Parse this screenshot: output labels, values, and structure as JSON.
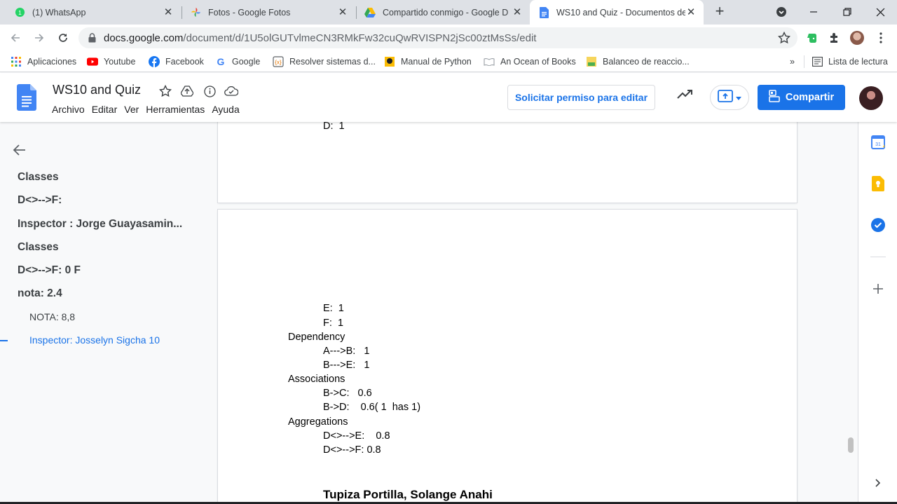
{
  "browser": {
    "tabs": [
      {
        "title": "(1) WhatsApp",
        "icon": "whatsapp-icon"
      },
      {
        "title": "Fotos - Google Fotos",
        "icon": "google-photos-icon"
      },
      {
        "title": "Compartido conmigo - Google D",
        "icon": "google-drive-icon"
      },
      {
        "title": "WS10 and Quiz - Documentos de",
        "icon": "google-docs-icon"
      }
    ],
    "url_host": "docs.google.com",
    "url_path": "/document/d/1U5olGUTvlmeCN3RMkFw32cuQwRVISPN2jSc00ztMsSs/edit",
    "bookmarks": [
      {
        "label": "Aplicaciones",
        "icon": "apps-grid-icon"
      },
      {
        "label": "Youtube",
        "icon": "youtube-icon"
      },
      {
        "label": "Facebook",
        "icon": "facebook-icon"
      },
      {
        "label": "Google",
        "icon": "google-icon"
      },
      {
        "label": "Resolver sistemas d...",
        "icon": "calculator-icon"
      },
      {
        "label": "Manual de Python",
        "icon": "python-book-icon"
      },
      {
        "label": "An Ocean of Books",
        "icon": "book-icon"
      },
      {
        "label": "Balanceo de reaccio...",
        "icon": "chemistry-icon"
      }
    ],
    "bookmarks_overflow": "»",
    "reading_list": "Lista de lectura"
  },
  "docs": {
    "title": "WS10 and Quiz",
    "menu": [
      "Archivo",
      "Editar",
      "Ver",
      "Herramientas",
      "Ayuda"
    ],
    "request_edit": "Solicitar permiso para editar",
    "share": "Compartir"
  },
  "outline": {
    "items": [
      {
        "label": "Classes",
        "level": "h2"
      },
      {
        "label": "D<>-->F:",
        "level": "h2"
      },
      {
        "label": "Inspector : Jorge Guayasamin...",
        "level": "h2"
      },
      {
        "label": "Classes",
        "level": "h2"
      },
      {
        "label": "D<>-->F: 0 F",
        "level": "h2"
      },
      {
        "label": "nota: 2.4",
        "level": "h2"
      },
      {
        "label": "NOTA: 8,8",
        "level": "h3"
      },
      {
        "label": "Inspector: Josselyn Sigcha 10",
        "level": "h3",
        "current": true
      }
    ]
  },
  "document": {
    "page1_lines": [
      {
        "text": "D:  1",
        "indent": 1
      }
    ],
    "page2_lines": [
      {
        "text": "E:  1",
        "indent": 1
      },
      {
        "text": "F:  1",
        "indent": 1
      },
      {
        "text": "Dependency",
        "indent": 0
      },
      {
        "text": "A--->B:   1",
        "indent": 1
      },
      {
        "text": "B--->E:   1",
        "indent": 1
      },
      {
        "text": "Associations",
        "indent": 0
      },
      {
        "text": "B->C:   0.6",
        "indent": 1
      },
      {
        "text": "B->D:    0.6( 1  has 1)",
        "indent": 1
      },
      {
        "text": "Aggregations",
        "indent": 0
      },
      {
        "text": "D<>-->E:    0.8",
        "indent": 1
      },
      {
        "text": "D<>-->F: 0.8",
        "indent": 1
      }
    ],
    "author": "Tupiza Portilla, Solange Anahi"
  },
  "colors": {
    "accent": "#1a73e8",
    "docs_blue": "#4285f4"
  }
}
